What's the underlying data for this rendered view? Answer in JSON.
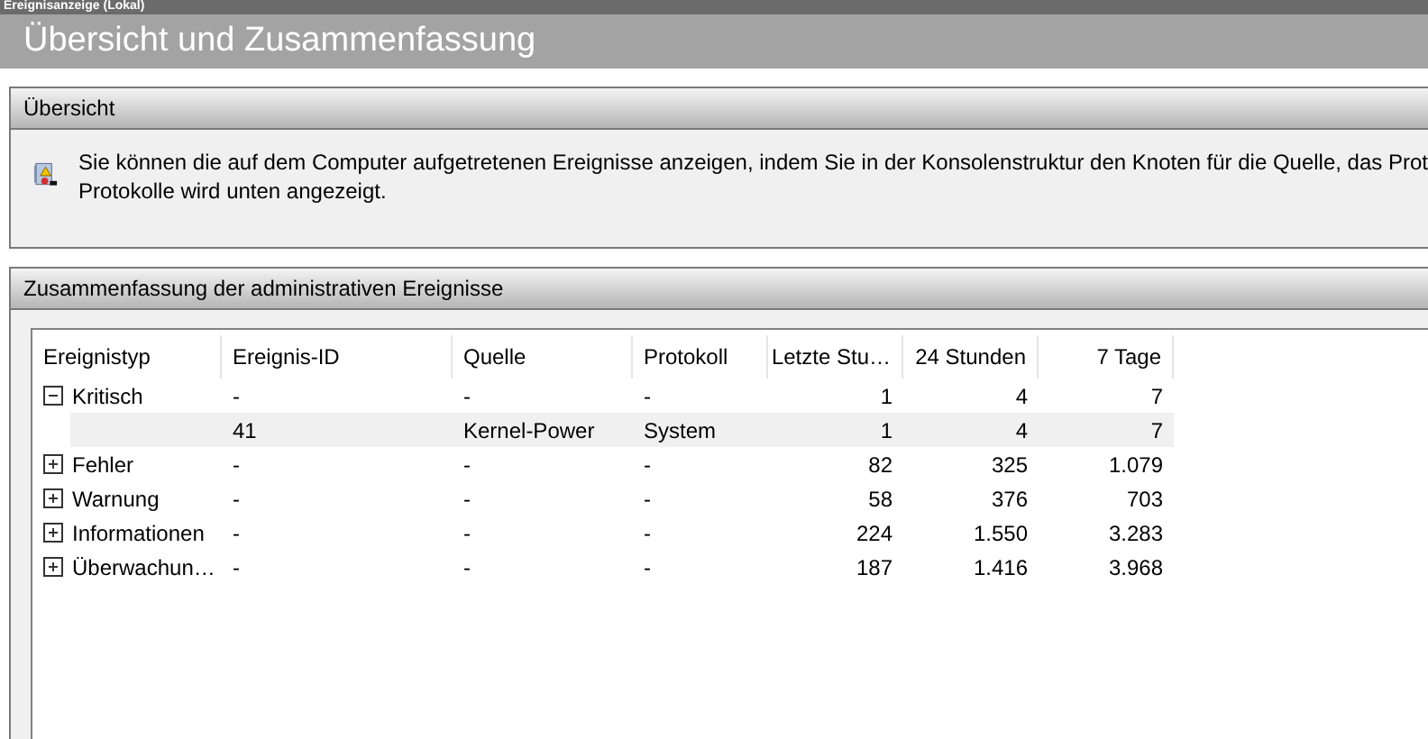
{
  "window": {
    "title": "Ereignisanzeige (Lokal)"
  },
  "page_title": "Übersicht und Zusammenfassung",
  "overview": {
    "title": "Übersicht",
    "lines": [
      "Sie können die auf dem Computer aufgetretenen Ereignisse anzeigen, indem Sie in der Konsolenstruktur den Knoten für die Quelle, das Prot",
      "Protokolle wird unten angezeigt."
    ]
  },
  "summary": {
    "title": "Zusammenfassung der administrativen Ereignisse",
    "table": {
      "columns": [
        "Ereignistyp",
        "Ereignis-ID",
        "Quelle",
        "Protokoll",
        "Letzte Stu…",
        "24 Stunden",
        "7 Tage"
      ],
      "rows": [
        {
          "cells": [
            "Kritisch",
            "-",
            "-",
            "-",
            "1",
            "4",
            "7"
          ],
          "expanded": true,
          "selected": false,
          "children": [
            {
              "cells": [
                "",
                "41",
                "Kernel-Power",
                "System",
                "1",
                "4",
                "7"
              ],
              "selected": true
            }
          ]
        },
        {
          "cells": [
            "Fehler",
            "-",
            "-",
            "-",
            "82",
            "325",
            "1.079"
          ],
          "expanded": false,
          "selected": false
        },
        {
          "cells": [
            "Warnung",
            "-",
            "-",
            "-",
            "58",
            "376",
            "703"
          ],
          "expanded": false,
          "selected": false
        },
        {
          "cells": [
            "Informationen",
            "-",
            "-",
            "-",
            "224",
            "1.550",
            "3.283"
          ],
          "expanded": false,
          "selected": false
        },
        {
          "cells": [
            "Überwachun…",
            "-",
            "-",
            "-",
            "187",
            "1.416",
            "3.968"
          ],
          "expanded": false,
          "selected": false
        }
      ]
    }
  }
}
